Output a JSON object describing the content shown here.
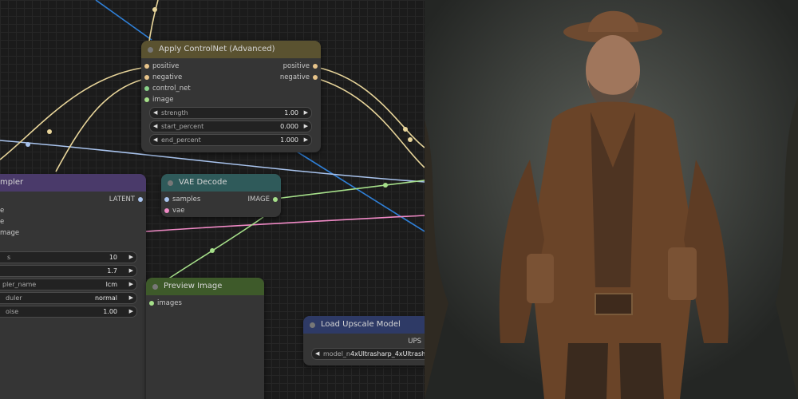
{
  "nodes": {
    "controlnet": {
      "title": "Apply ControlNet (Advanced)",
      "inputs": [
        "positive",
        "negative",
        "control_net",
        "image"
      ],
      "outputs": [
        "positive",
        "negative"
      ],
      "widgets": [
        {
          "label": "strength",
          "value": "1.00"
        },
        {
          "label": "start_percent",
          "value": "0.000"
        },
        {
          "label": "end_percent",
          "value": "1.000"
        }
      ]
    },
    "sampler": {
      "title": "mpler",
      "output": "LATENT",
      "inputs": [
        "e",
        "e",
        "mage"
      ],
      "widgets": [
        {
          "label": "s",
          "value": "10"
        },
        {
          "label": "",
          "value": "1.7"
        },
        {
          "label": "pler_name",
          "value": "lcm"
        },
        {
          "label": "duler",
          "value": "normal"
        },
        {
          "label": "oise",
          "value": "1.00"
        }
      ]
    },
    "vae_decode": {
      "title": "VAE Decode",
      "inputs": [
        "samples",
        "vae"
      ],
      "output": "IMAGE"
    },
    "preview": {
      "title": "Preview Image",
      "inputs": [
        "images"
      ]
    },
    "upscale": {
      "title": "Load Upscale Model",
      "output": "UPS",
      "widget_label": "model_n",
      "widget_value": "4xUltrasharp_4xUltrasha"
    }
  },
  "colors": {
    "controlnet_header": "#5a5230",
    "sampler_header": "#4a3a6a",
    "vae_header": "#2f5a5a",
    "preview_header": "#3e5a2a",
    "upscale_header": "#2e3a66",
    "conditioning_wire": "#e8d59a",
    "latent_wire": "#a9c4ee",
    "image_wire": "#a6e08a",
    "vae_wire": "#f08ac6",
    "model_wire": "#2f7fd6"
  }
}
